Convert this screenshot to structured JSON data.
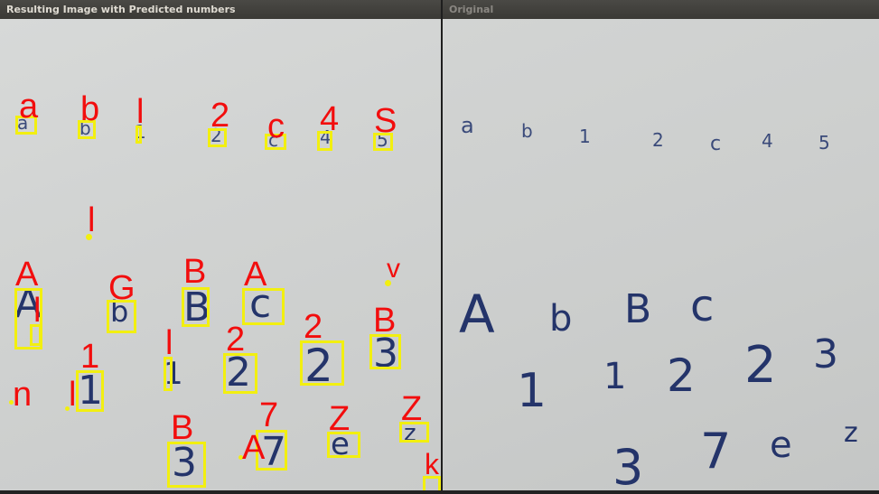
{
  "left_window": {
    "title": "Resulting Image with Predicted numbers",
    "predictions": [
      "a",
      "b",
      "l",
      "2",
      "c",
      "4",
      "S",
      "l",
      "A",
      "l",
      "G",
      "B",
      "A",
      "v",
      "1",
      "l",
      "2",
      "2",
      "B",
      "n",
      "l",
      "B",
      "A",
      "7",
      "Z",
      "Z",
      "k"
    ],
    "box_color": "#f2ef10",
    "label_color": "#f20d0d"
  },
  "right_window": {
    "title": "Original",
    "row1": [
      "a",
      "b",
      "1",
      "2",
      "c",
      "4",
      "5"
    ],
    "row2": [
      "A",
      "b",
      "B",
      "c"
    ],
    "row3": [
      "1",
      "1",
      "2",
      "2",
      "3"
    ],
    "row4": [
      "3",
      "7",
      "e",
      "z"
    ]
  }
}
